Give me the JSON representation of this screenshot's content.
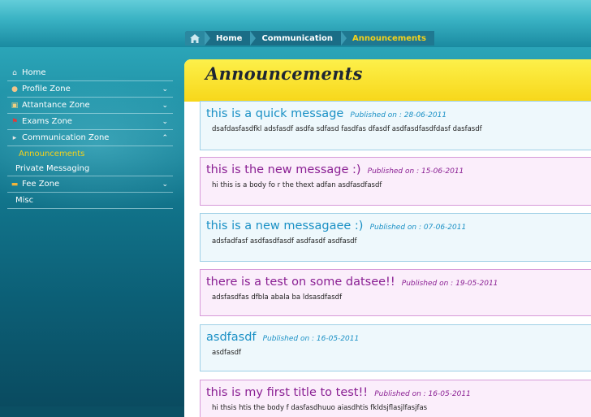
{
  "breadcrumb": {
    "items": [
      "Home",
      "Communication",
      "Announcements"
    ]
  },
  "sidebar": {
    "items": [
      {
        "label": "Home",
        "icon": "house-icon"
      },
      {
        "label": "Profile Zone",
        "icon": "user-icon"
      },
      {
        "label": "Attantance Zone",
        "icon": "clipboard-icon"
      },
      {
        "label": "Exams Zone",
        "icon": "flag-icon"
      },
      {
        "label": "Communication Zone",
        "icon": "megaphone-icon"
      },
      {
        "label": "Announcements"
      },
      {
        "label": "Private Messaging"
      },
      {
        "label": "Fee Zone",
        "icon": "card-icon"
      },
      {
        "label": "Misc"
      }
    ]
  },
  "main": {
    "title": "Announcements",
    "published_prefix": "Published on : ",
    "announcements": [
      {
        "title": "this is a quick message",
        "date": "28-06-2011",
        "body": "dsafdasfasdfkl adsfasdf asdfa sdfasd fasdfas dfasdf asdfasdfasdfdasf dasfasdf",
        "style": "blue"
      },
      {
        "title": "this is the new message :)",
        "date": "15-06-2011",
        "body": "hi this is a body fo r the thext adfan asdfasdfasdf",
        "style": "pink"
      },
      {
        "title": "this is a new messagaee :)",
        "date": "07-06-2011",
        "body": "adsfadfasf asdfasdfasdf asdfasdf asdfasdf",
        "style": "blue"
      },
      {
        "title": "there is a test on some datsee!!",
        "date": "19-05-2011",
        "body": "adsfasdfas dfbla abala ba ldsasdfasdf",
        "style": "pink"
      },
      {
        "title": "asdfasdf",
        "date": "16-05-2011",
        "body": "asdfasdf",
        "style": "blue"
      },
      {
        "title": "this is my first title to test!!",
        "date": "16-05-2011",
        "body": "hi thsis htis the body f dasfasdhuuo aiasdhtis fkldsjflasjlfasjfas",
        "style": "pink"
      }
    ]
  },
  "colors": {
    "accent_yellow": "#f5d21b",
    "title_blue": "#1a90c5",
    "title_purple": "#8a1f93",
    "header_bar": "#f7d71a"
  }
}
